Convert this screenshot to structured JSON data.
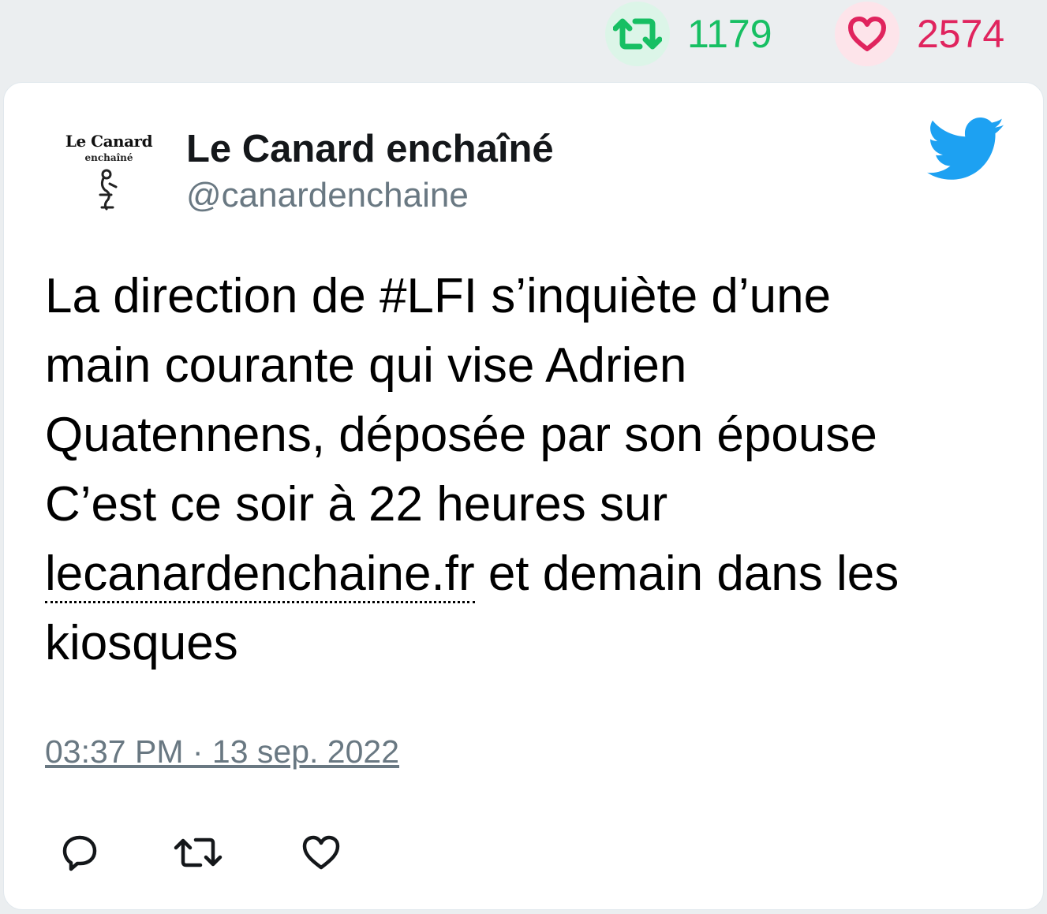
{
  "stats": {
    "retweet_count": "1179",
    "like_count": "2574",
    "retweet_icon": "retweet-icon",
    "like_icon": "heart-icon",
    "retweet_color": "#17bf63",
    "like_color": "#e0245e"
  },
  "author": {
    "name": "Le Canard enchaîné",
    "handle": "@canardenchaine",
    "avatar_logo_text": "Le Canard",
    "avatar_logo_sub": "enchaîné",
    "avatar_icon": "duck-logo-icon"
  },
  "platform_icon": "twitter-bird-icon",
  "platform_color": "#1da1f2",
  "tweet": {
    "line1": "La direction de #LFI s’inquiète d’une",
    "line2": "main courante qui vise Adrien",
    "line3": "Quatennens, déposée par son épouse",
    "line4": "C’est ce soir à 22 heures sur",
    "link": "lecanardenchaine.fr",
    "line5_rest": " et demain dans les",
    "line6": "kiosques"
  },
  "timestamp": "03:37 PM · 13 sep. 2022",
  "actions": {
    "reply_icon": "reply-icon",
    "retweet_icon": "retweet-icon",
    "like_icon": "heart-icon"
  }
}
